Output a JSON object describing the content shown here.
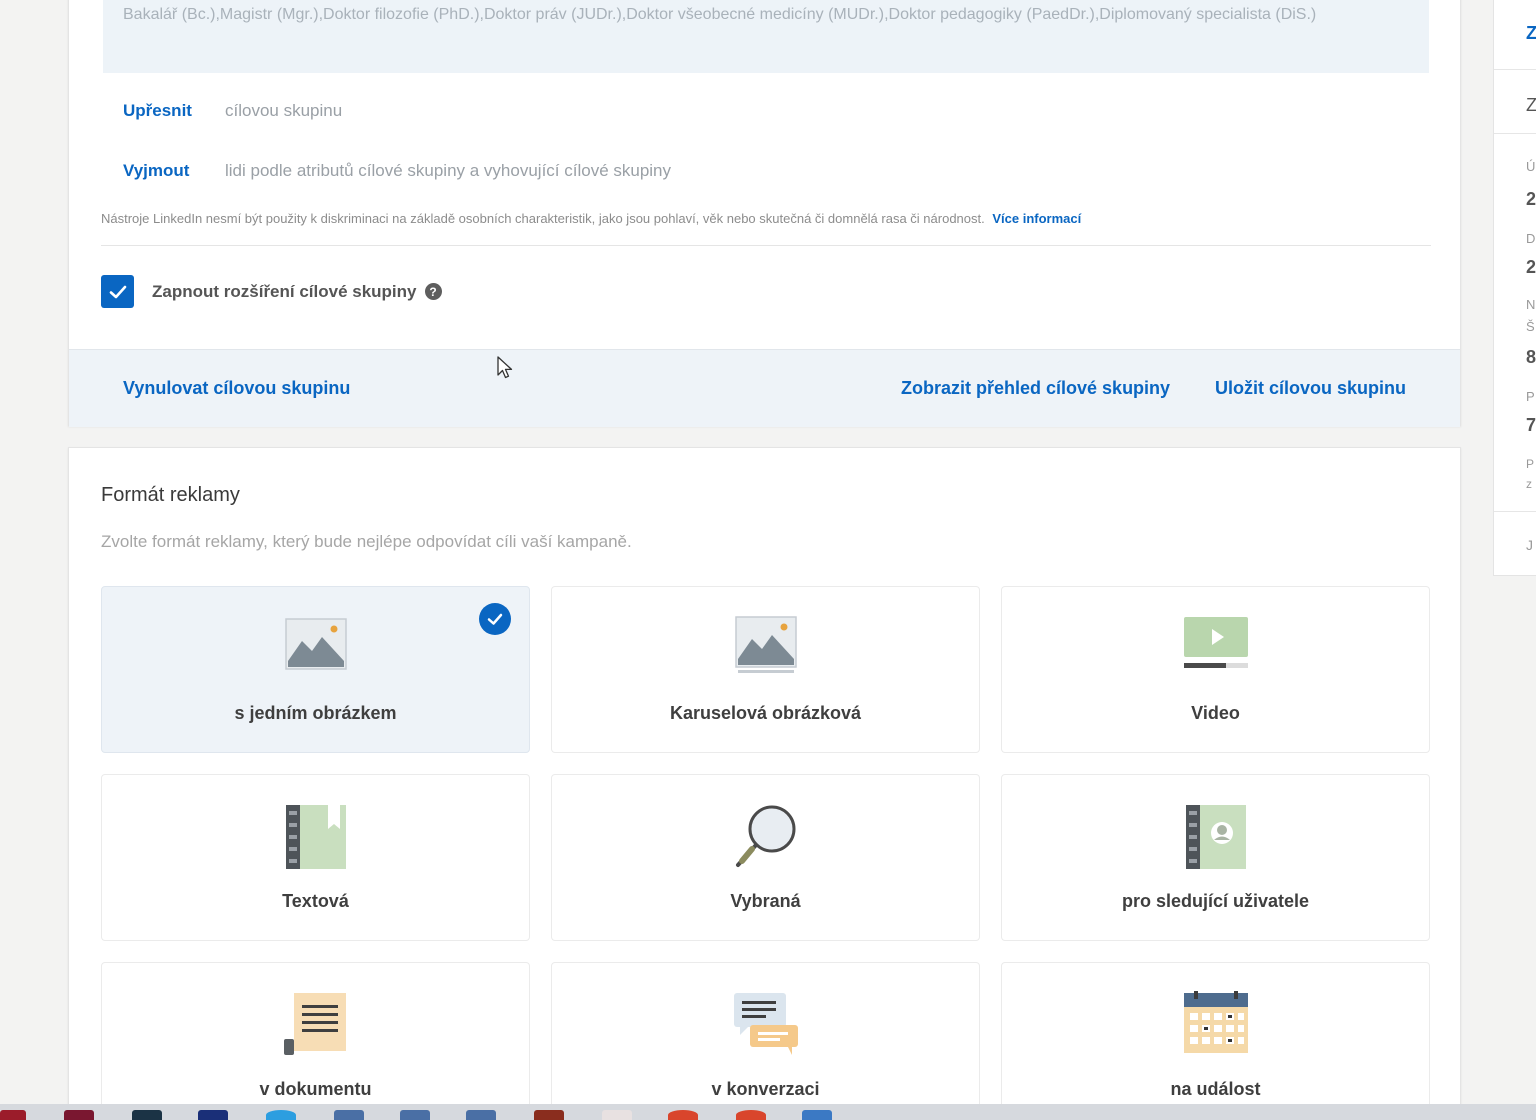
{
  "audience": {
    "education_text": "Bakalář (Bc.),Magistr (Mgr.),Doktor filozofie (PhD.),Doktor práv (JUDr.),Doktor všeobecné medicíny (MUDr.),Doktor pedagogiky (PaedDr.),Diplomovaný specialista (DiS.)",
    "narrow": {
      "link": "Upřesnit",
      "text": "cílovou skupinu"
    },
    "exclude": {
      "link": "Vyjmout",
      "text": "lidi podle atributů cílové skupiny a vyhovující cílové skupiny"
    },
    "notice": "Nástroje LinkedIn nesmí být použity k diskriminaci na základě osobních charakteristik, jako jsou pohlaví, věk nebo skutečná či domnělá rasa či národnost.",
    "notice_link": "Více informací",
    "expansion_label": "Zapnout rozšíření cílové skupiny",
    "expansion_checked": true,
    "help_glyph": "?",
    "footer": {
      "reset": "Vynulovat cílovou skupinu",
      "overview": "Zobrazit přehled cílové skupiny",
      "save": "Uložit cílovou skupinu"
    }
  },
  "ad_format": {
    "title": "Formát reklamy",
    "subtitle": "Zvolte formát reklamy, který bude nejlépe odpovídat cíli vaší kampaně.",
    "options": [
      {
        "label": "s jedním obrázkem",
        "icon": "single-image-icon",
        "selected": true
      },
      {
        "label": "Karuselová obrázková",
        "icon": "carousel-image-icon",
        "selected": false
      },
      {
        "label": "Video",
        "icon": "video-icon",
        "selected": false
      },
      {
        "label": "Textová",
        "icon": "text-ad-icon",
        "selected": false
      },
      {
        "label": "Vybraná",
        "icon": "spotlight-magnifier-icon",
        "selected": false
      },
      {
        "label": "pro sledující uživatele",
        "icon": "follower-contact-book-icon",
        "selected": false
      },
      {
        "label": "v dokumentu",
        "icon": "document-icon",
        "selected": false
      },
      {
        "label": "v konverzaci",
        "icon": "conversation-icon",
        "selected": false
      },
      {
        "label": "na událost",
        "icon": "event-calendar-icon",
        "selected": false
      }
    ]
  },
  "side_panel": {
    "chars": [
      "Z",
      "Z",
      "Ú",
      "2",
      "D",
      "2",
      "N",
      "Š",
      "8",
      "P",
      "7",
      "P",
      "z",
      "J"
    ]
  },
  "colors": {
    "accent": "#0a66c2",
    "selected_tile_bg": "#eef3f8",
    "footer_bg": "#eef3f8"
  }
}
